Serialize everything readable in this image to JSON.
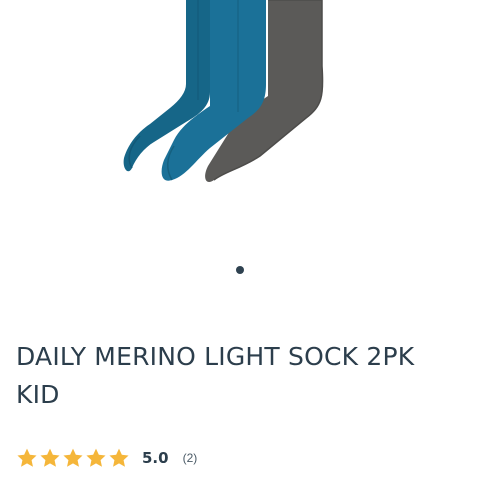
{
  "product": {
    "title": "DAILY MERINO LIGHT SOCK 2PK KID",
    "image_alt": "blue and grey merino socks",
    "colors": {
      "blue": "#1a6e93",
      "grey": "#5b5a58",
      "star": "#f5b63a",
      "text": "#2c3e4c"
    }
  },
  "gallery": {
    "slide_count": 1,
    "active_slide": 1
  },
  "rating": {
    "stars": 5,
    "value": "5.0",
    "count": "(2)"
  }
}
